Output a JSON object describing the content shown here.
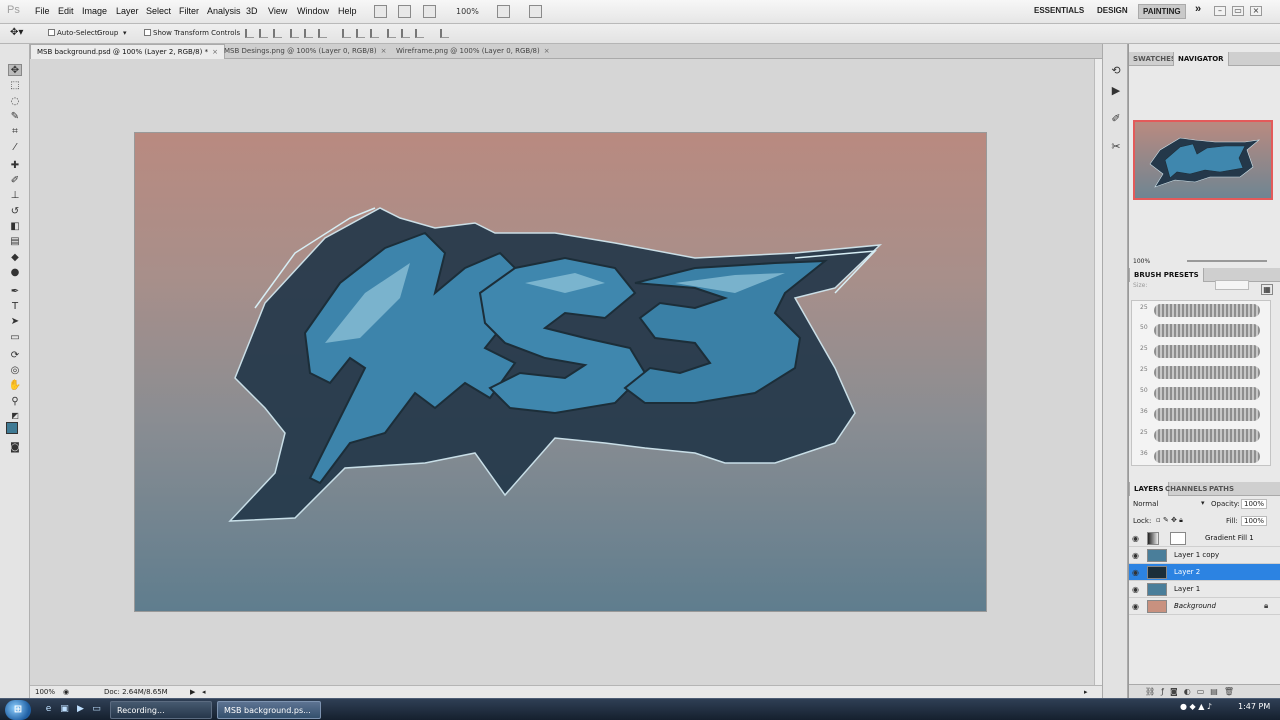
{
  "app": {
    "logo": "Ps"
  },
  "menu": [
    "File",
    "Edit",
    "Image",
    "Layer",
    "Select",
    "Filter",
    "Analysis",
    "3D",
    "View",
    "Window",
    "Help"
  ],
  "menubar": {
    "zoom": "100%",
    "workspaces": [
      "ESSENTIALS",
      "DESIGN",
      "PAINTING"
    ],
    "active_workspace": "PAINTING",
    "more": "»"
  },
  "options": {
    "auto_select_label": "Auto-Select:",
    "auto_select_value": "Group",
    "show_transform_label": "Show Transform Controls"
  },
  "tabs": [
    {
      "label": "MSB background.psd @ 100% (Layer 2, RGB/8) *",
      "active": true
    },
    {
      "label": "MSB Desings.png @ 100% (Layer 0, RGB/8)",
      "active": false
    },
    {
      "label": "Wireframe.png @ 100% (Layer 0, RGB/8)",
      "active": false
    }
  ],
  "canvas": {
    "artwork_colors": {
      "fill": "#3f86ad",
      "outline": "#1c2e39",
      "highlight": "#8fc3d8"
    }
  },
  "status": {
    "zoom": "100%",
    "doc": "Doc: 2.64M/8.65M"
  },
  "panels": {
    "top_tabs": [
      "SWATCHES",
      "NAVIGATOR"
    ],
    "navigator_zoom": "100%",
    "brush_presets_title": "BRUSH PRESETS",
    "brush_size_label": "Size:",
    "brush_nums": [
      "25",
      "50",
      "25",
      "25",
      "50",
      "36",
      "25",
      "36"
    ],
    "layers_tabs": [
      "LAYERS",
      "CHANNELS",
      "PATHS"
    ],
    "blend_mode": "Normal",
    "opacity_label": "Opacity:",
    "opacity_value": "100%",
    "lock_label": "Lock:",
    "fill_label": "Fill:",
    "fill_value": "100%",
    "layers": [
      {
        "name": "Gradient Fill 1",
        "selected": false
      },
      {
        "name": "Layer 1 copy",
        "selected": false
      },
      {
        "name": "Layer 2",
        "selected": true
      },
      {
        "name": "Layer 1",
        "selected": false
      },
      {
        "name": "Background",
        "selected": false,
        "locked": true
      }
    ]
  },
  "taskbar": {
    "start": "⊞",
    "tasks": [
      {
        "label": "Recording...",
        "active": false
      },
      {
        "label": "MSB background.ps...",
        "active": true
      }
    ],
    "clock": "1:47 PM"
  },
  "colors": {
    "accent_selection": "#2c83e2",
    "nav_frame": "#e35a5a"
  }
}
